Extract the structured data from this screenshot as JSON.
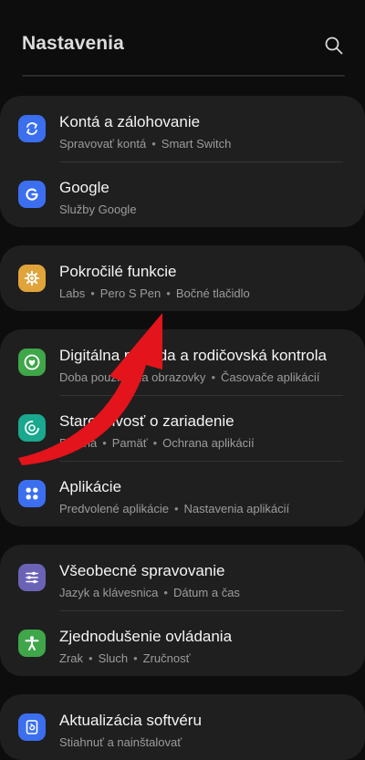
{
  "header": {
    "title": "Nastavenia"
  },
  "cards": [
    {
      "items": [
        {
          "title": "Kontá a zálohovanie",
          "subtitle": [
            "Spravovať kontá",
            "Smart Switch"
          ],
          "icon": "sync-icon",
          "color": "#3b6ff0"
        },
        {
          "title": "Google",
          "subtitle": [
            "Služby Google"
          ],
          "icon": "google-icon",
          "color": "#3b6ff0"
        }
      ]
    },
    {
      "items": [
        {
          "title": "Pokročilé funkcie",
          "subtitle": [
            "Labs",
            "Pero S Pen",
            "Bočné tlačidlo"
          ],
          "icon": "gear-plus-icon",
          "color": "#e0a43a"
        }
      ]
    },
    {
      "items": [
        {
          "title": "Digitálna pohoda a rodičovská kontrola",
          "subtitle": [
            "Doba používania obrazovky",
            "Časovače aplikácií"
          ],
          "icon": "heart-circle-icon",
          "color": "#3fa64a"
        },
        {
          "title": "Starostlivosť o zariadenie",
          "subtitle": [
            "Batéria",
            "Pamäť",
            "Ochrana aplikácií"
          ],
          "icon": "device-care-icon",
          "color": "#1aa88e"
        },
        {
          "title": "Aplikácie",
          "subtitle": [
            "Predvolené aplikácie",
            "Nastavenia aplikácií"
          ],
          "icon": "apps-grid-icon",
          "color": "#3b6ff0"
        }
      ]
    },
    {
      "items": [
        {
          "title": "Všeobecné spravovanie",
          "subtitle": [
            "Jazyk a klávesnica",
            "Dátum a čas"
          ],
          "icon": "sliders-icon",
          "color": "#6a63b5"
        },
        {
          "title": "Zjednodušenie ovládania",
          "subtitle": [
            "Zrak",
            "Sluch",
            "Zručnosť"
          ],
          "icon": "accessibility-icon",
          "color": "#3fa64a"
        }
      ]
    },
    {
      "items": [
        {
          "title": "Aktualizácia softvéru",
          "subtitle": [
            "Stiahnuť a nainštalovať"
          ],
          "icon": "software-update-icon",
          "color": "#3b6ff0"
        }
      ]
    }
  ],
  "overlay": {
    "arrow_color": "#e3141b"
  }
}
